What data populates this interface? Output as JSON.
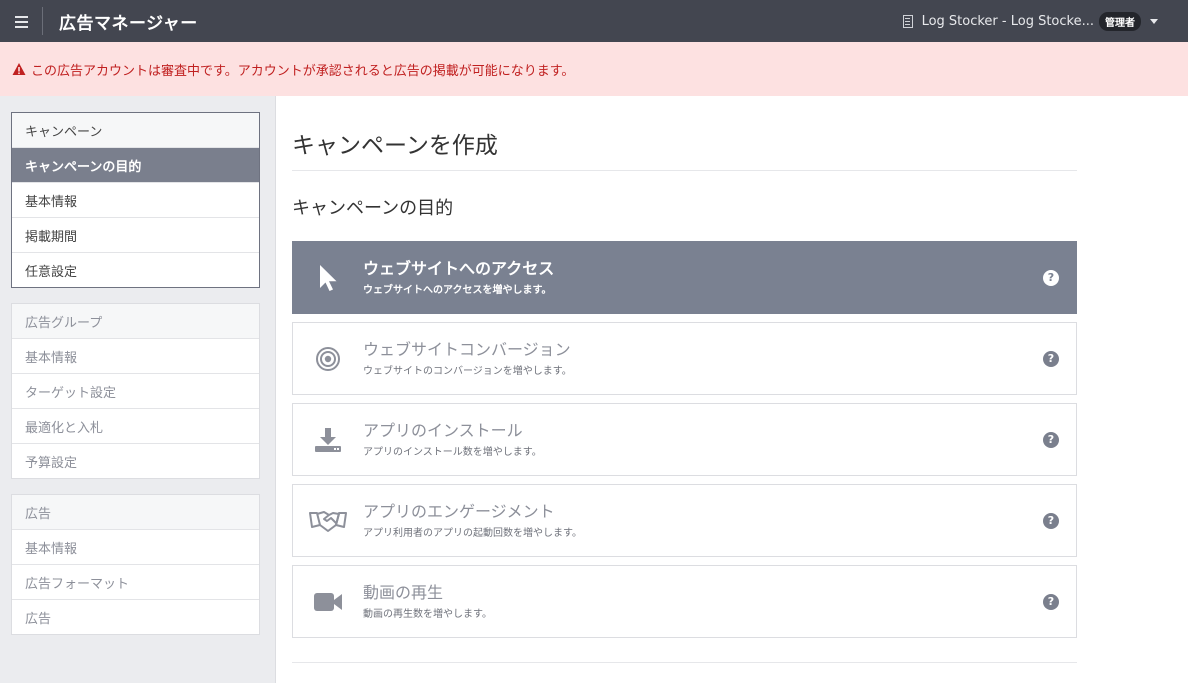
{
  "header": {
    "app_title": "広告マネージャー",
    "account_name": "Log Stocker - Log Stocke...",
    "role_badge": "管理者"
  },
  "alert": {
    "message": "この広告アカウントは審査中です。アカウントが承認されると広告の掲載が可能になります。",
    "color": "#c02020"
  },
  "sidebar": {
    "campaign": {
      "header": "キャンペーン",
      "items": [
        "キャンペーンの目的",
        "基本情報",
        "掲載期間",
        "任意設定"
      ],
      "selected": "キャンペーンの目的"
    },
    "ad_group": {
      "header": "広告グループ",
      "items": [
        "基本情報",
        "ターゲット設定",
        "最適化と入札",
        "予算設定"
      ]
    },
    "ad": {
      "header": "広告",
      "items": [
        "基本情報",
        "広告フォーマット",
        "広告"
      ]
    }
  },
  "main": {
    "page_title": "キャンペーンを作成",
    "section_title": "キャンペーンの目的",
    "objectives": [
      {
        "title": "ウェブサイトへのアクセス",
        "description": "ウェブサイトへのアクセスを増やします。",
        "icon": "cursor-icon",
        "selected": true
      },
      {
        "title": "ウェブサイトコンバージョン",
        "description": "ウェブサイトのコンバージョンを増やします。",
        "icon": "target-icon",
        "selected": false
      },
      {
        "title": "アプリのインストール",
        "description": "アプリのインストール数を増やします。",
        "icon": "download-icon",
        "selected": false
      },
      {
        "title": "アプリのエンゲージメント",
        "description": "アプリ利用者のアプリの起動回数を増やします。",
        "icon": "handshake-icon",
        "selected": false
      },
      {
        "title": "動画の再生",
        "description": "動画の再生数を増やします。",
        "icon": "video-camera-icon",
        "selected": false
      }
    ],
    "help_glyph": "?"
  },
  "colors": {
    "topbar": "#434650",
    "alert_bg": "#fde1e1",
    "selected_item": "#7a7f8d"
  }
}
